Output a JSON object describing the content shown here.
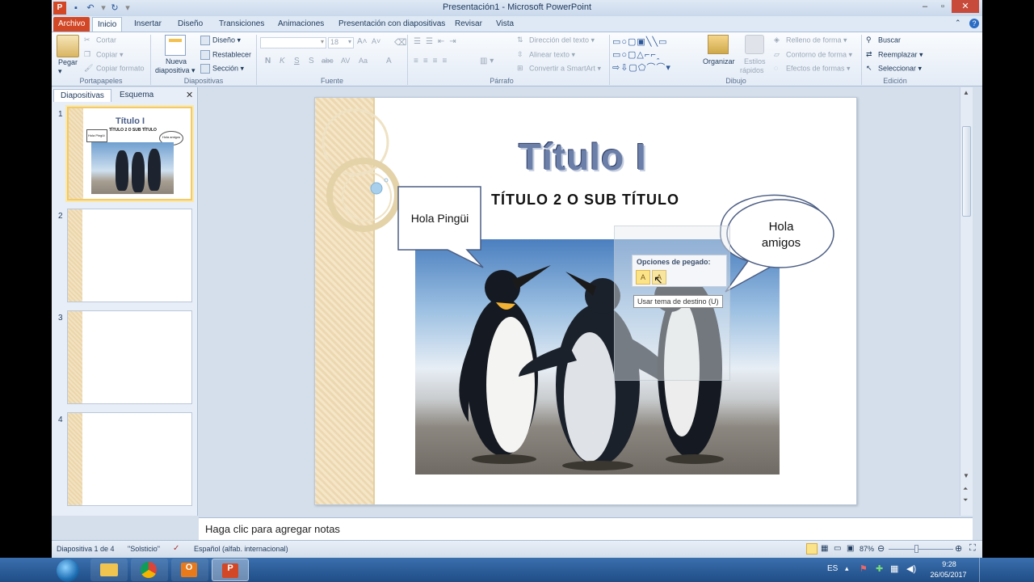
{
  "window": {
    "title": "Presentación1 - Microsoft PowerPoint"
  },
  "tabs": [
    "Archivo",
    "Inicio",
    "Insertar",
    "Diseño",
    "Transiciones",
    "Animaciones",
    "Presentación con diapositivas",
    "Revisar",
    "Vista"
  ],
  "ribbon": {
    "portapapeles": {
      "label": "Portapapeles",
      "pegar": "Pegar",
      "cortar": "Cortar",
      "copiar": "Copiar",
      "copiar_formato": "Copiar formato"
    },
    "diapositivas": {
      "label": "Diapositivas",
      "nueva_1": "Nueva",
      "nueva_2": "diapositiva",
      "diseno": "Diseño",
      "restablecer": "Restablecer",
      "seccion": "Sección"
    },
    "fuente": {
      "label": "Fuente",
      "font_value": "",
      "size_value": "18",
      "buttons": [
        "N",
        "K",
        "S",
        "S",
        "abc",
        "AV",
        "Aa",
        "A"
      ]
    },
    "parrafo": {
      "label": "Párrafo",
      "direccion": "Dirección del texto",
      "alinear": "Alinear texto",
      "smartart": "Convertir a SmartArt"
    },
    "dibujo": {
      "label": "Dibujo",
      "organizar": "Organizar",
      "estilos_1": "Estilos",
      "estilos_2": "rápidos",
      "relleno": "Relleno de forma",
      "contorno": "Contorno de forma",
      "efectos": "Efectos de formas"
    },
    "edicion": {
      "label": "Edición",
      "buscar": "Buscar",
      "reemplazar": "Reemplazar",
      "seleccionar": "Seleccionar"
    }
  },
  "left_panel": {
    "tab_diapositivas": "Diapositivas",
    "tab_esquema": "Esquema",
    "thumbs": [
      {
        "num": "1",
        "title": "Título I",
        "subtitle": "TÍTULO 2 O SUB TÍTULO",
        "bubble_left": "Hola Pingüi",
        "bubble_right": "Hola amigos"
      },
      {
        "num": "2"
      },
      {
        "num": "3"
      },
      {
        "num": "4"
      }
    ]
  },
  "slide": {
    "title": "Título I",
    "subtitle": "TÍTULO 2 O SUB TÍTULO",
    "callout_left": "Hola Pingüi",
    "callout_right_1": "Hola",
    "callout_right_2": "amigos",
    "paste_options_label": "Opciones de pegado:",
    "tooltip": "Usar tema de destino (U)"
  },
  "notes": {
    "placeholder": "Haga clic para agregar notas"
  },
  "status": {
    "slide_info": "Diapositiva 1 de 4",
    "theme": "\"Solsticio\"",
    "language": "Español (alfab. internacional)",
    "zoom": "87%"
  },
  "taskbar": {
    "lang": "ES",
    "time": "9:28",
    "date": "26/05/2017"
  },
  "colors": {
    "file_tab": "#d24726",
    "ribbon_bg": "#e3ebf6",
    "title_text": "#6b7fa8"
  }
}
